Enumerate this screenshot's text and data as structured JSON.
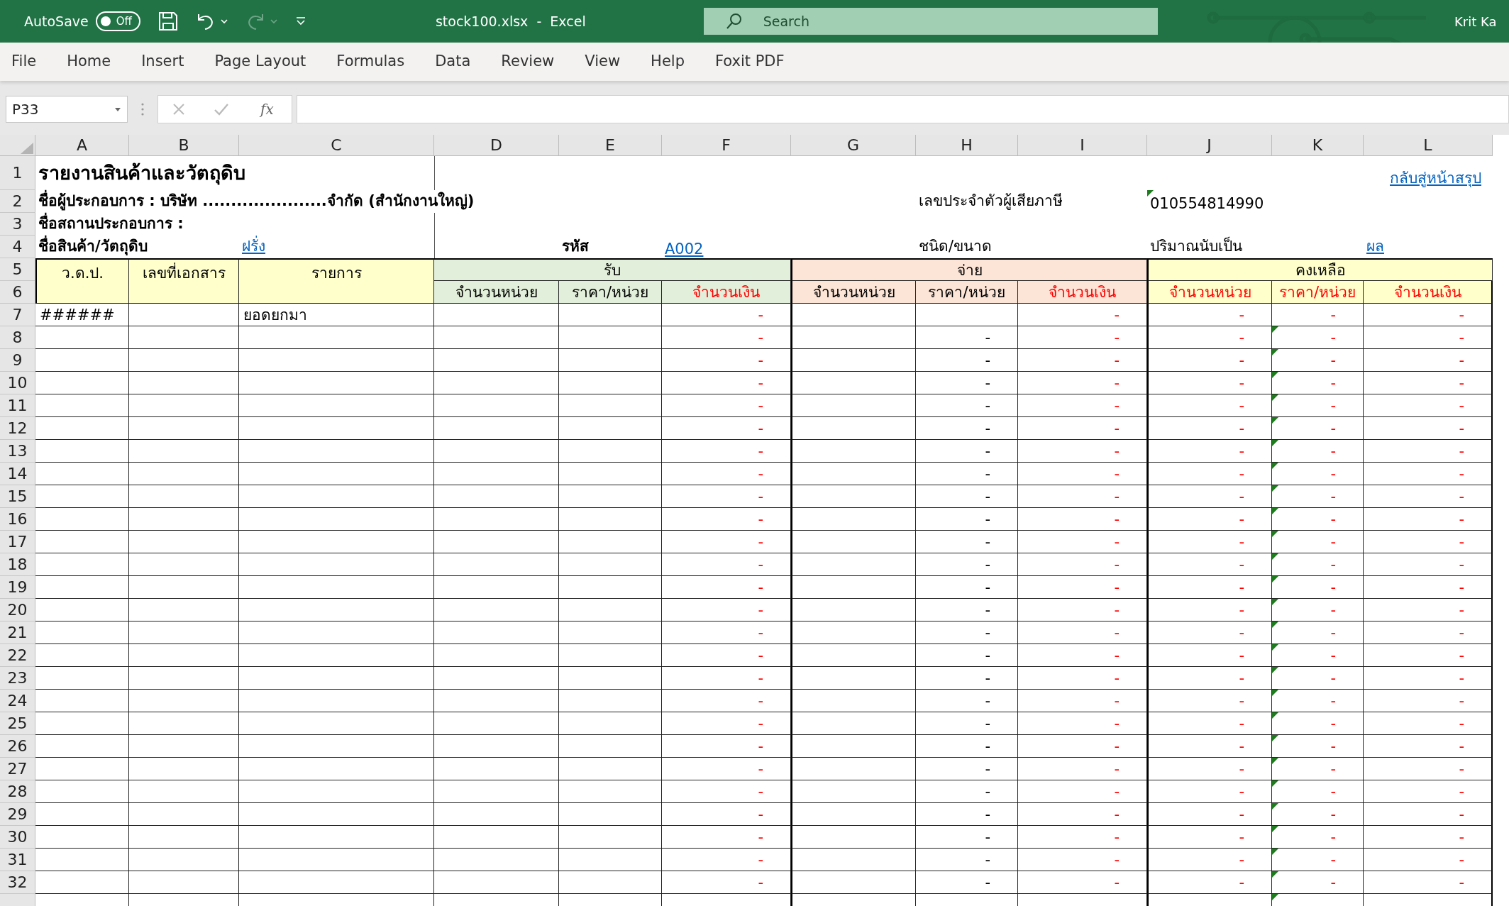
{
  "title_bar": {
    "autosave_label": "AutoSave",
    "autosave": {
      "on": false,
      "label": "Off"
    },
    "redo_disabled": true,
    "document_title": "stock100.xlsx  -  Excel",
    "search": {
      "placeholder": "Search"
    },
    "user": "Krit Ka"
  },
  "ribbon_tabs": [
    {
      "label": "File",
      "selected": false
    },
    {
      "label": "Home",
      "selected": false
    },
    {
      "label": "Insert",
      "selected": false
    },
    {
      "label": "Page Layout",
      "selected": false
    },
    {
      "label": "Formulas",
      "selected": false
    },
    {
      "label": "Data",
      "selected": false
    },
    {
      "label": "Review",
      "selected": false
    },
    {
      "label": "View",
      "selected": false
    },
    {
      "label": "Help",
      "selected": false
    },
    {
      "label": "Foxit PDF",
      "selected": false
    }
  ],
  "formula_bar": {
    "name_box": "P33",
    "function_label": "fx"
  },
  "columns": [
    "A",
    "B",
    "C",
    "D",
    "E",
    "F",
    "G",
    "H",
    "I",
    "J",
    "K",
    "L"
  ],
  "header_row_numbers": [
    "1",
    "2",
    "3",
    "4",
    "5",
    "6"
  ],
  "sheet": {
    "title": "รายงานสินค้าและวัตถุดิบ",
    "back_link": "กลับสู่หน้าสรุป",
    "operator_line": "ชื่อผู้ประกอบการ : บริษัท ......................จำกัด (สำนักงานใหญ่)",
    "tax_id_label": "เลขประจำตัวผู้เสียภาษี",
    "tax_id": "010554814990",
    "tax_id_flagged": true,
    "place_label": "ชื่อสถานประกอบการ :",
    "product_label": "ชื่อสินค้า/วัตถุดิบ",
    "product_name": "ฝรั่ง",
    "code_label": "รหัส",
    "code": "A002",
    "type_label": "ชนิด/ขนาด",
    "unit_label": "ปริมาณนับเป็น",
    "unit": "ผล"
  },
  "table_header": {
    "fixed": [
      "ว.ด.ป.",
      "เลขที่เอกสาร",
      "รายการ"
    ],
    "groups": [
      {
        "label": "รับ",
        "color": "#e2efda",
        "subheaders": [
          {
            "label": "จำนวนหน่วย",
            "color": "#000000"
          },
          {
            "label": "ราคา/หน่วย",
            "color": "#000000"
          },
          {
            "label": "จำนวนเงิน",
            "color": "#ff0000"
          }
        ]
      },
      {
        "label": "จ่าย",
        "color": "#fce4d6",
        "subheaders": [
          {
            "label": "จำนวนหน่วย",
            "color": "#000000"
          },
          {
            "label": "ราคา/หน่วย",
            "color": "#000000"
          },
          {
            "label": "จำนวนเงิน",
            "color": "#ff0000"
          }
        ]
      },
      {
        "label": "คงเหลือ",
        "color": "#ffffcc",
        "subheaders": [
          {
            "label": "จำนวนหน่วย",
            "color": "#ff0000"
          },
          {
            "label": "ราคา/หน่วย",
            "color": "#ff0000"
          },
          {
            "label": "จำนวนเงิน",
            "color": "#ff0000"
          }
        ]
      }
    ]
  },
  "rows": [
    {
      "number": "7",
      "cells": {
        "A": "######",
        "C": "ยอดยกมา",
        "F": "-",
        "I": "-",
        "J": "-",
        "K": "-",
        "L": "-"
      },
      "flag_k": false
    },
    {
      "number": "8",
      "cells": {
        "F": "-",
        "H": "-",
        "I": "-",
        "J": "-",
        "K": "-",
        "L": "-"
      },
      "flag_k": true
    },
    {
      "number": "9",
      "cells": {
        "F": "-",
        "H": "-",
        "I": "-",
        "J": "-",
        "K": "-",
        "L": "-"
      },
      "flag_k": true
    },
    {
      "number": "10",
      "cells": {
        "F": "-",
        "H": "-",
        "I": "-",
        "J": "-",
        "K": "-",
        "L": "-"
      },
      "flag_k": true
    },
    {
      "number": "11",
      "cells": {
        "F": "-",
        "H": "-",
        "I": "-",
        "J": "-",
        "K": "-",
        "L": "-"
      },
      "flag_k": true
    },
    {
      "number": "12",
      "cells": {
        "F": "-",
        "H": "-",
        "I": "-",
        "J": "-",
        "K": "-",
        "L": "-"
      },
      "flag_k": true
    },
    {
      "number": "13",
      "cells": {
        "F": "-",
        "H": "-",
        "I": "-",
        "J": "-",
        "K": "-",
        "L": "-"
      },
      "flag_k": true
    },
    {
      "number": "14",
      "cells": {
        "F": "-",
        "H": "-",
        "I": "-",
        "J": "-",
        "K": "-",
        "L": "-"
      },
      "flag_k": true
    },
    {
      "number": "15",
      "cells": {
        "F": "-",
        "H": "-",
        "I": "-",
        "J": "-",
        "K": "-",
        "L": "-"
      },
      "flag_k": true
    },
    {
      "number": "16",
      "cells": {
        "F": "-",
        "H": "-",
        "I": "-",
        "J": "-",
        "K": "-",
        "L": "-"
      },
      "flag_k": true
    },
    {
      "number": "17",
      "cells": {
        "F": "-",
        "H": "-",
        "I": "-",
        "J": "-",
        "K": "-",
        "L": "-"
      },
      "flag_k": true
    },
    {
      "number": "18",
      "cells": {
        "F": "-",
        "H": "-",
        "I": "-",
        "J": "-",
        "K": "-",
        "L": "-"
      },
      "flag_k": true
    },
    {
      "number": "19",
      "cells": {
        "F": "-",
        "H": "-",
        "I": "-",
        "J": "-",
        "K": "-",
        "L": "-"
      },
      "flag_k": true
    },
    {
      "number": "20",
      "cells": {
        "F": "-",
        "H": "-",
        "I": "-",
        "J": "-",
        "K": "-",
        "L": "-"
      },
      "flag_k": true
    },
    {
      "number": "21",
      "cells": {
        "F": "-",
        "H": "-",
        "I": "-",
        "J": "-",
        "K": "-",
        "L": "-"
      },
      "flag_k": true
    },
    {
      "number": "22",
      "cells": {
        "F": "-",
        "H": "-",
        "I": "-",
        "J": "-",
        "K": "-",
        "L": "-"
      },
      "flag_k": true
    },
    {
      "number": "23",
      "cells": {
        "F": "-",
        "H": "-",
        "I": "-",
        "J": "-",
        "K": "-",
        "L": "-"
      },
      "flag_k": true
    },
    {
      "number": "24",
      "cells": {
        "F": "-",
        "H": "-",
        "I": "-",
        "J": "-",
        "K": "-",
        "L": "-"
      },
      "flag_k": true
    },
    {
      "number": "25",
      "cells": {
        "F": "-",
        "H": "-",
        "I": "-",
        "J": "-",
        "K": "-",
        "L": "-"
      },
      "flag_k": true
    },
    {
      "number": "26",
      "cells": {
        "F": "-",
        "H": "-",
        "I": "-",
        "J": "-",
        "K": "-",
        "L": "-"
      },
      "flag_k": true
    },
    {
      "number": "27",
      "cells": {
        "F": "-",
        "H": "-",
        "I": "-",
        "J": "-",
        "K": "-",
        "L": "-"
      },
      "flag_k": true
    },
    {
      "number": "28",
      "cells": {
        "F": "-",
        "H": "-",
        "I": "-",
        "J": "-",
        "K": "-",
        "L": "-"
      },
      "flag_k": true
    },
    {
      "number": "29",
      "cells": {
        "F": "-",
        "H": "-",
        "I": "-",
        "J": "-",
        "K": "-",
        "L": "-"
      },
      "flag_k": true
    },
    {
      "number": "30",
      "cells": {
        "F": "-",
        "H": "-",
        "I": "-",
        "J": "-",
        "K": "-",
        "L": "-"
      },
      "flag_k": true
    },
    {
      "number": "31",
      "cells": {
        "F": "-",
        "H": "-",
        "I": "-",
        "J": "-",
        "K": "-",
        "L": "-"
      },
      "flag_k": true
    },
    {
      "number": "32",
      "cells": {
        "F": "-",
        "H": "-",
        "I": "-",
        "J": "-",
        "K": "-",
        "L": "-"
      },
      "flag_k": true
    },
    {
      "cells": {},
      "flag_k": true
    }
  ]
}
